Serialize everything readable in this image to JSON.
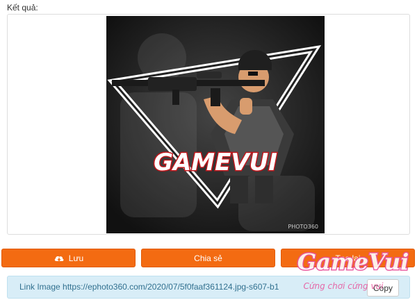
{
  "result": {
    "label": "Kết quả:"
  },
  "image": {
    "logo_text": "GAMEVUI",
    "credit_text": "PHOTO360"
  },
  "buttons": {
    "save_label": "Lưu",
    "share_label": "Chia sẻ",
    "recreate_label": "Tạo lại"
  },
  "link": {
    "prefix": "Link Image",
    "url": "https://ephoto360.com/2020/07/5f0faaf361124.jpg-s607-b1",
    "copy_label": "Copy"
  },
  "watermark": {
    "logo_text": "GameVui",
    "tagline": "Cứng chơi cứng vui"
  },
  "colors": {
    "accent": "#f36b12",
    "info_bg": "#d8edf7",
    "info_text": "#31708f"
  }
}
